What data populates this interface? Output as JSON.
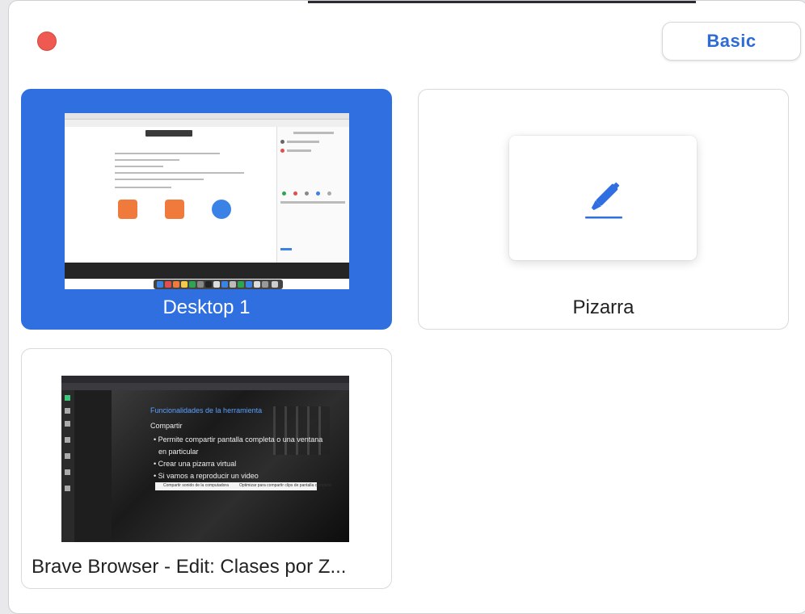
{
  "window": {
    "mode_button_label": "Basic",
    "colors": {
      "accent": "#2f6fe0",
      "close": "#ee5a52",
      "basic_text": "#2d6bd6"
    }
  },
  "share_options": [
    {
      "label": "Desktop 1",
      "selected": true
    },
    {
      "label": "Pizarra",
      "selected": false
    },
    {
      "label": "Brave Browser - Edit: Clases por Z...",
      "selected": false
    }
  ],
  "brave_preview": {
    "slide_title": "Funcionalidades de la herramienta",
    "heading": "Compartir",
    "bullets": [
      "Permite compartir pantalla completa o una ventana",
      "en particular",
      "Crear una pizarra virtual",
      "Si vamos a reproducir un video"
    ],
    "checkbox_1": "Compartir sonido de la computadora",
    "checkbox_2": "Optimizar para compartir clips de pantalla completa"
  },
  "icons": {
    "close": "close-dot-icon",
    "whiteboard": "pen-marker-icon"
  }
}
